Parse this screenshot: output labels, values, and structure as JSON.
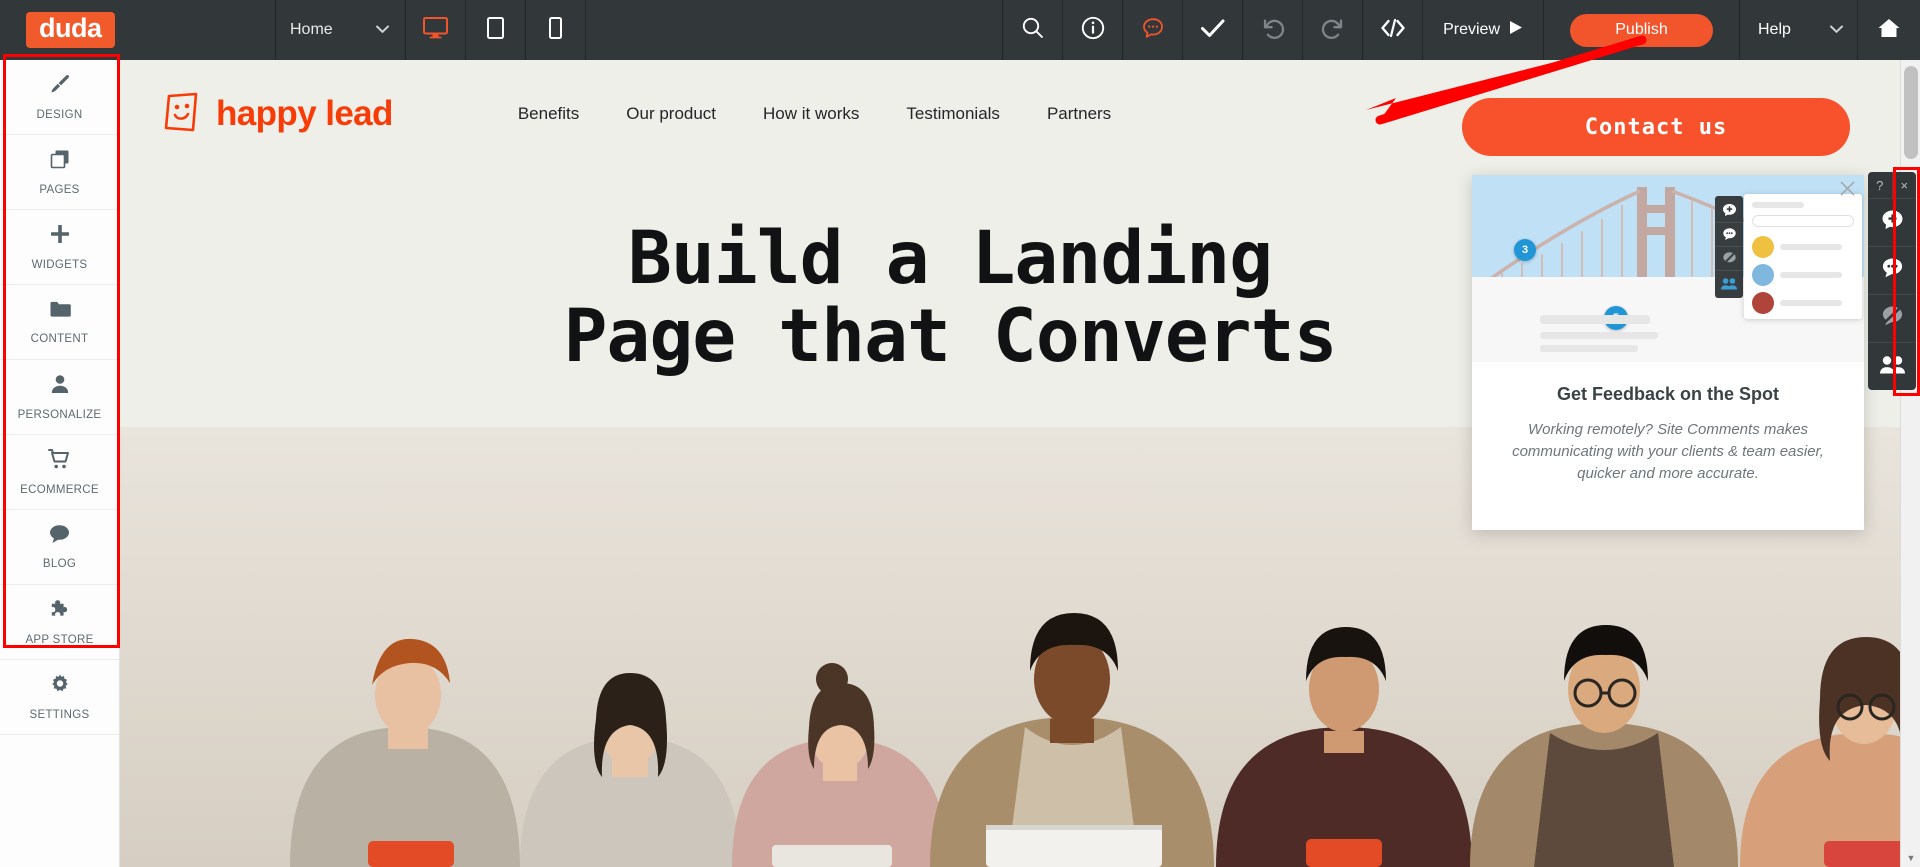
{
  "topbar": {
    "logo": "duda",
    "page_selector": {
      "value": "Home",
      "chevron": "chevron-down-icon"
    },
    "devices": [
      {
        "name": "desktop",
        "icon": "desktop-icon",
        "active": true
      },
      {
        "name": "tablet",
        "icon": "tablet-icon",
        "active": false
      },
      {
        "name": "mobile",
        "icon": "mobile-icon",
        "active": false
      }
    ],
    "actions": [
      {
        "name": "search",
        "icon": "search-icon"
      },
      {
        "name": "info",
        "icon": "info-circle-icon"
      },
      {
        "name": "site-comments",
        "icon": "comment-dots-icon",
        "active": true
      },
      {
        "name": "save",
        "icon": "check-icon"
      },
      {
        "name": "undo",
        "icon": "undo-icon",
        "disabled": true
      },
      {
        "name": "redo",
        "icon": "redo-icon",
        "disabled": true
      },
      {
        "name": "code",
        "icon": "code-brackets-icon"
      }
    ],
    "preview_label": "Preview",
    "preview_icon": "play-triangle-icon",
    "publish_label": "Publish",
    "help_label": "Help",
    "home_icon": "home-icon",
    "accent_color": "#f2552c",
    "bar_color": "#32373a"
  },
  "sidebar": {
    "items": [
      {
        "label": "DESIGN",
        "icon": "paintbrush-icon"
      },
      {
        "label": "PAGES",
        "icon": "pages-stack-icon"
      },
      {
        "label": "WIDGETS",
        "icon": "plus-icon"
      },
      {
        "label": "CONTENT",
        "icon": "folder-icon"
      },
      {
        "label": "PERSONALIZE",
        "icon": "person-icon"
      },
      {
        "label": "ECOMMERCE",
        "icon": "shopping-cart-icon"
      },
      {
        "label": "BLOG",
        "icon": "speech-bubble-icon"
      },
      {
        "label": "APP STORE",
        "icon": "puzzle-piece-icon"
      },
      {
        "label": "SETTINGS",
        "icon": "gear-icon"
      }
    ]
  },
  "site": {
    "brand_name": "happy lead",
    "brand_icon": "smiley-face-logo-icon",
    "brand_color": "#f73c08",
    "nav": [
      "Benefits",
      "Our product",
      "How it works",
      "Testimonials",
      "Partners"
    ],
    "cta_label": "Contact us",
    "hero_line1": "Build a Landing",
    "hero_line2": "Page that Converts"
  },
  "popup": {
    "title": "Get Feedback on the Spot",
    "description": "Working remotely? Site Comments makes communicating with your clients & team easier, quicker and more accurate.",
    "close_icon": "close-icon",
    "pins": [
      "3",
      "5"
    ],
    "mini_toolbar_icons": [
      "add-comment-icon",
      "comment-icon",
      "hide-comments-icon",
      "collaborators-icon"
    ]
  },
  "right_tools": {
    "help_label": "?",
    "close_label": "×",
    "buttons": [
      {
        "name": "add-comment",
        "icon": "add-comment-icon"
      },
      {
        "name": "comments",
        "icon": "comment-icon"
      },
      {
        "name": "hide-comments",
        "icon": "hide-comments-icon"
      },
      {
        "name": "collaborators",
        "icon": "collaborators-icon"
      }
    ]
  },
  "annotations": {
    "arrow": "red-arrow-pointing-to-publish",
    "boxes": [
      "left-sidebar-highlight",
      "right-tools-highlight"
    ],
    "color": "#ff0000"
  },
  "scrollbar": {
    "up_arrow": "▲",
    "down_arrow": "▼"
  }
}
